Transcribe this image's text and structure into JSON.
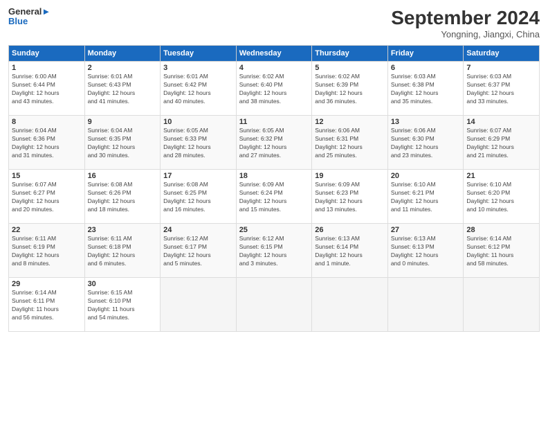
{
  "logo": {
    "line1": "General",
    "line2": "Blue"
  },
  "title": "September 2024",
  "location": "Yongning, Jiangxi, China",
  "days_of_week": [
    "Sunday",
    "Monday",
    "Tuesday",
    "Wednesday",
    "Thursday",
    "Friday",
    "Saturday"
  ],
  "weeks": [
    [
      {
        "day": "1",
        "sunrise": "6:00 AM",
        "sunset": "6:44 PM",
        "daylight": "12 hours and 43 minutes."
      },
      {
        "day": "2",
        "sunrise": "6:01 AM",
        "sunset": "6:43 PM",
        "daylight": "12 hours and 41 minutes."
      },
      {
        "day": "3",
        "sunrise": "6:01 AM",
        "sunset": "6:42 PM",
        "daylight": "12 hours and 40 minutes."
      },
      {
        "day": "4",
        "sunrise": "6:02 AM",
        "sunset": "6:40 PM",
        "daylight": "12 hours and 38 minutes."
      },
      {
        "day": "5",
        "sunrise": "6:02 AM",
        "sunset": "6:39 PM",
        "daylight": "12 hours and 36 minutes."
      },
      {
        "day": "6",
        "sunrise": "6:03 AM",
        "sunset": "6:38 PM",
        "daylight": "12 hours and 35 minutes."
      },
      {
        "day": "7",
        "sunrise": "6:03 AM",
        "sunset": "6:37 PM",
        "daylight": "12 hours and 33 minutes."
      }
    ],
    [
      {
        "day": "8",
        "sunrise": "6:04 AM",
        "sunset": "6:36 PM",
        "daylight": "12 hours and 31 minutes."
      },
      {
        "day": "9",
        "sunrise": "6:04 AM",
        "sunset": "6:35 PM",
        "daylight": "12 hours and 30 minutes."
      },
      {
        "day": "10",
        "sunrise": "6:05 AM",
        "sunset": "6:33 PM",
        "daylight": "12 hours and 28 minutes."
      },
      {
        "day": "11",
        "sunrise": "6:05 AM",
        "sunset": "6:32 PM",
        "daylight": "12 hours and 27 minutes."
      },
      {
        "day": "12",
        "sunrise": "6:06 AM",
        "sunset": "6:31 PM",
        "daylight": "12 hours and 25 minutes."
      },
      {
        "day": "13",
        "sunrise": "6:06 AM",
        "sunset": "6:30 PM",
        "daylight": "12 hours and 23 minutes."
      },
      {
        "day": "14",
        "sunrise": "6:07 AM",
        "sunset": "6:29 PM",
        "daylight": "12 hours and 21 minutes."
      }
    ],
    [
      {
        "day": "15",
        "sunrise": "6:07 AM",
        "sunset": "6:27 PM",
        "daylight": "12 hours and 20 minutes."
      },
      {
        "day": "16",
        "sunrise": "6:08 AM",
        "sunset": "6:26 PM",
        "daylight": "12 hours and 18 minutes."
      },
      {
        "day": "17",
        "sunrise": "6:08 AM",
        "sunset": "6:25 PM",
        "daylight": "12 hours and 16 minutes."
      },
      {
        "day": "18",
        "sunrise": "6:09 AM",
        "sunset": "6:24 PM",
        "daylight": "12 hours and 15 minutes."
      },
      {
        "day": "19",
        "sunrise": "6:09 AM",
        "sunset": "6:23 PM",
        "daylight": "12 hours and 13 minutes."
      },
      {
        "day": "20",
        "sunrise": "6:10 AM",
        "sunset": "6:21 PM",
        "daylight": "12 hours and 11 minutes."
      },
      {
        "day": "21",
        "sunrise": "6:10 AM",
        "sunset": "6:20 PM",
        "daylight": "12 hours and 10 minutes."
      }
    ],
    [
      {
        "day": "22",
        "sunrise": "6:11 AM",
        "sunset": "6:19 PM",
        "daylight": "12 hours and 8 minutes."
      },
      {
        "day": "23",
        "sunrise": "6:11 AM",
        "sunset": "6:18 PM",
        "daylight": "12 hours and 6 minutes."
      },
      {
        "day": "24",
        "sunrise": "6:12 AM",
        "sunset": "6:17 PM",
        "daylight": "12 hours and 5 minutes."
      },
      {
        "day": "25",
        "sunrise": "6:12 AM",
        "sunset": "6:15 PM",
        "daylight": "12 hours and 3 minutes."
      },
      {
        "day": "26",
        "sunrise": "6:13 AM",
        "sunset": "6:14 PM",
        "daylight": "12 hours and 1 minute."
      },
      {
        "day": "27",
        "sunrise": "6:13 AM",
        "sunset": "6:13 PM",
        "daylight": "12 hours and 0 minutes."
      },
      {
        "day": "28",
        "sunrise": "6:14 AM",
        "sunset": "6:12 PM",
        "daylight": "11 hours and 58 minutes."
      }
    ],
    [
      {
        "day": "29",
        "sunrise": "6:14 AM",
        "sunset": "6:11 PM",
        "daylight": "11 hours and 56 minutes."
      },
      {
        "day": "30",
        "sunrise": "6:15 AM",
        "sunset": "6:10 PM",
        "daylight": "11 hours and 54 minutes."
      },
      null,
      null,
      null,
      null,
      null
    ]
  ]
}
